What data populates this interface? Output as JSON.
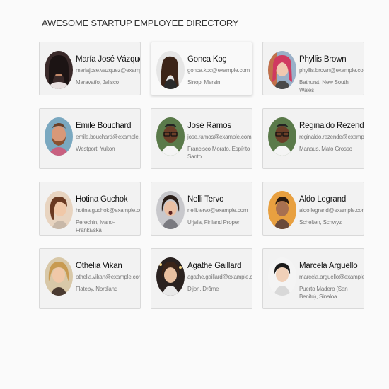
{
  "page": {
    "title": "AWESOME STARTUP EMPLOYEE DIRECTORY"
  },
  "employees": [
    {
      "name": "María José Vázquez",
      "email": "mariajose.vazquez@example.com",
      "location": "Maravatío, Jalisco",
      "avatar": "woman-dark-hair-photo"
    },
    {
      "name": "Gonca Koç",
      "email": "gonca.koc@example.com",
      "location": "Sinop, Mersin",
      "avatar": "woman-long-brown-hair-photo"
    },
    {
      "name": "Phyllis Brown",
      "email": "phyllis.brown@example.com",
      "location": "Bathurst, New South Wales",
      "avatar": "woman-red-hair-photo"
    },
    {
      "name": "Emile Bouchard",
      "email": "emile.bouchard@example.com",
      "location": "Westport, Yukon",
      "avatar": "man-beard-photo"
    },
    {
      "name": "José Ramos",
      "email": "jose.ramos@example.com",
      "location": "Francisco Morato, Espírito Santo",
      "avatar": "man-glasses-photo"
    },
    {
      "name": "Reginaldo Rezende",
      "email": "reginaldo.rezende@example.com",
      "location": "Manaus, Mato Grosso",
      "avatar": "man-glasses-photo"
    },
    {
      "name": "Hotina Guchok",
      "email": "hotina.guchok@example.com",
      "location": "Perechin, Ivano-Frankivska",
      "avatar": "woman-curly-hair-photo"
    },
    {
      "name": "Nelli Tervo",
      "email": "nelli.tervo@example.com",
      "location": "Urjala, Finland Proper",
      "avatar": "woman-dark-hair-photo"
    },
    {
      "name": "Aldo Legrand",
      "email": "aldo.legrand@example.com",
      "location": "Schelten, Schwyz",
      "avatar": "man-orange-background-photo"
    },
    {
      "name": "Othelia Vikan",
      "email": "othelia.vikan@example.com",
      "location": "Flateby, Nordland",
      "avatar": "woman-blonde-hair-photo"
    },
    {
      "name": "Agathe Gaillard",
      "email": "agathe.gaillard@example.com",
      "location": "Dijon, Drôme",
      "avatar": "woman-curly-dark-hair-photo"
    },
    {
      "name": "Marcela Arguello",
      "email": "marcela.arguello@example.com",
      "location": "Puerto Madero (San Benito), Sinaloa",
      "avatar": "woman-short-dark-hair-photo"
    }
  ]
}
